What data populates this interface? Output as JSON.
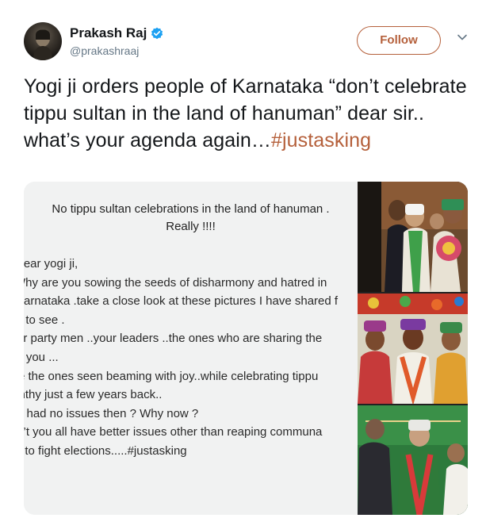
{
  "user": {
    "display_name": "Prakash Raj",
    "handle": "@prakashraaj",
    "verified": true
  },
  "actions": {
    "follow_label": "Follow"
  },
  "tweet": {
    "text": "Yogi ji orders people of Karnataka “don’t celebrate tippu sultan in the land of hanuman” dear sir.. what’s your agenda again…",
    "hashtag": "#justasking"
  },
  "note": {
    "title_line1": "No tippu sultan celebrations in the land of hanuman .",
    "title_line2": "Really !!!!",
    "lines": [
      "Dear yogi ji,",
      "Why are you sowing the seeds of disharmony and hatred in",
      "Karnataka .take a close look at these pictures I have shared f",
      "you to see .",
      "Your party men ..your leaders ..the ones who are sharing the",
      "with you ...",
      "Are the ones seen beaming with joy..while celebrating tippu",
      "jayanthy just a few years back..",
      "You had no issues then ? Why now ?",
      "Don’t you all have better issues other than reaping communa",
      "harvest to fight elections.....#justasking"
    ]
  },
  "icons": {
    "verified": "verified-badge-icon",
    "caret": "chevron-down-icon"
  },
  "colors": {
    "accent": "#b5603b",
    "verified": "#1da1f2",
    "secondary_text": "#657786"
  }
}
